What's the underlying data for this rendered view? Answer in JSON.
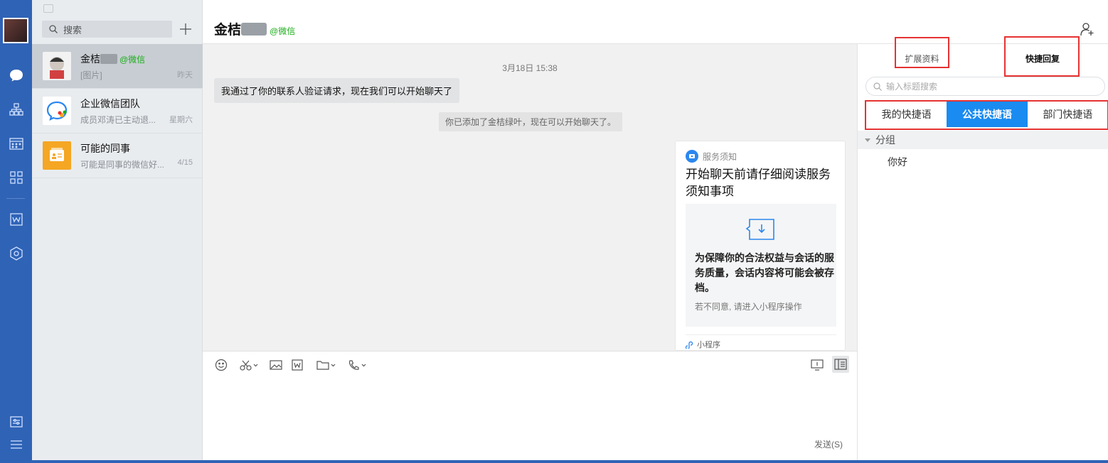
{
  "window": {
    "minimize_icon": "minimize-icon",
    "maximize_icon": "maximize-icon",
    "close_icon": "close-icon"
  },
  "navbar": {
    "items": [
      "messages-icon",
      "contacts-icon",
      "calendar-icon",
      "workbench-icon",
      "docs-icon",
      "drive-icon"
    ],
    "bottom": [
      "settings-icon",
      "menu-icon"
    ],
    "accent": "#2f63b6"
  },
  "conv_list": {
    "search_placeholder": "搜索",
    "items": [
      {
        "name": "金桔",
        "tag": "@微信",
        "preview": "[图片]",
        "time": "昨天"
      },
      {
        "name": "企业微信团队",
        "tag": "",
        "preview": "成员邓涛已主动退...",
        "time": "星期六"
      },
      {
        "name": "可能的同事",
        "tag": "",
        "preview": "可能是同事的微信好...",
        "time": "4/15"
      }
    ]
  },
  "chat": {
    "title": "金桔",
    "title_tag": "@微信",
    "timestamp": "3月18日 15:38",
    "incoming_message": "我通过了你的联系人验证请求，现在我们可以开始聊天了",
    "system_note": "你已添加了金桔绿叶，现在可以开始聊天了。",
    "card": {
      "source": "服务须知",
      "title": "开始聊天前请仔细阅读服务须知事项",
      "body": "为保障你的合法权益与会话的服务质量，会话内容将可能会被存档。",
      "hint": "若不同意, 请进入小程序操作",
      "footer": "小程序"
    },
    "send_label": "发送(S)"
  },
  "right_panel": {
    "tabs": [
      "扩展资料",
      "快捷回复"
    ],
    "search_placeholder": "输入标题搜索",
    "segments": [
      "我的快捷语",
      "公共快捷语",
      "部门快捷语"
    ],
    "group_label": "分组",
    "phrase": "你好",
    "highlight_color": "#1a8bf1",
    "annotation_color": "#e63232"
  }
}
